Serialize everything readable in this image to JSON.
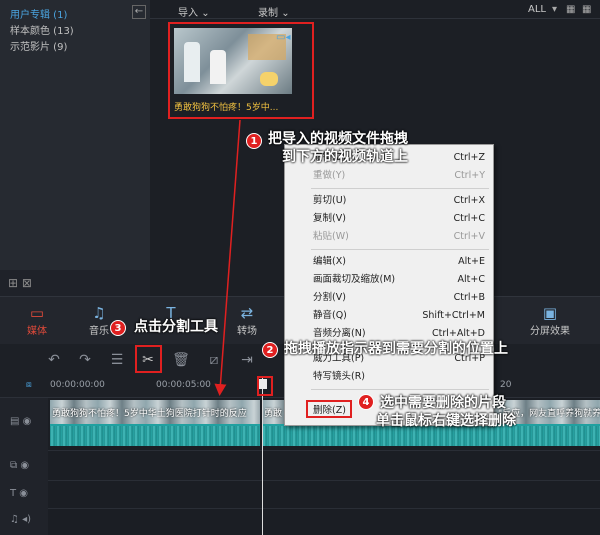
{
  "library": {
    "items": [
      "用户专辑 (1)",
      "样本颜色 (13)",
      "示范影片 (9)"
    ],
    "collapse_icon": "←"
  },
  "media_toolbar": {
    "import_label": "导入",
    "record_label": "录制",
    "all_label": "ALL"
  },
  "thumbnail": {
    "label": "勇敢狗狗不怕疼！5岁中..."
  },
  "annotations": {
    "a1_num": "1",
    "a1_line1": "把导入的视频文件拖拽",
    "a1_line2": "到下方的视频轨道上",
    "a2_num": "2",
    "a2_text": "拖拽播放指示器到需要分割的位置上",
    "a3_num": "3",
    "a3_text": "点击分割工具",
    "a4_num": "4",
    "a4_line1": "选中需要删除的片段",
    "a4_line2": "单击鼠标右键选择删除"
  },
  "context_menu": {
    "items": [
      {
        "label": "撤销(Z)",
        "key": "Ctrl+Z",
        "disabled": false
      },
      {
        "label": "重做(Y)",
        "key": "Ctrl+Y",
        "disabled": true
      },
      {
        "label": "剪切(U)",
        "key": "Ctrl+X",
        "disabled": false
      },
      {
        "label": "复制(V)",
        "key": "Ctrl+C",
        "disabled": false
      },
      {
        "label": "粘贴(W)",
        "key": "Ctrl+V",
        "disabled": true
      },
      {
        "label": "编辑(X)",
        "key": "Alt+E",
        "disabled": false
      },
      {
        "label": "画面裁切及缩放(M)",
        "key": "Alt+C",
        "disabled": false
      },
      {
        "label": "分割(V)",
        "key": "Ctrl+B",
        "disabled": false
      },
      {
        "label": "静音(Q)",
        "key": "Shift+Ctrl+M",
        "disabled": false
      },
      {
        "label": "音频分离(N)",
        "key": "Ctrl+Alt+D",
        "disabled": false
      },
      {
        "label": "威力工具(P)",
        "key": "Ctrl+P",
        "disabled": false
      },
      {
        "label": "特写镜头(R)",
        "key": "",
        "disabled": false
      },
      {
        "label": "删除(Z)",
        "key": "",
        "disabled": false
      }
    ]
  },
  "modules": {
    "media": "媒体",
    "audio": "音乐",
    "title": "",
    "transition": "转场",
    "split_screen": "分屏效果"
  },
  "ruler": {
    "t0": "00:00:00:00",
    "t1": "00:00:05:00",
    "t2": "20"
  },
  "clips": {
    "clip1_title": "勇敢狗狗不怕疼！5岁中华土狗医院打针时的反应",
    "clip2_title": "勇敢",
    "clip2_tail": "\"反应，网友直呼养狗就养中华土狗，值得你拥有"
  }
}
